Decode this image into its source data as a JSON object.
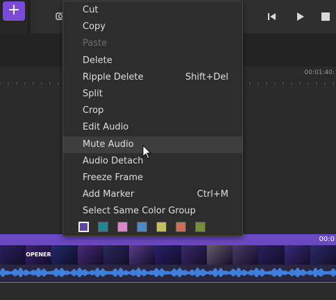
{
  "toolbar": {
    "add_glyph": "+"
  },
  "ruler": {
    "tick_time": "00:01:40:"
  },
  "track": {
    "time": "00:0"
  },
  "video_thumbs": [
    {
      "label": "",
      "color": "#2a1f5c"
    },
    {
      "label": "OPENERS",
      "color": "#3a1f6e"
    },
    {
      "label": "",
      "color": "#1f2a6a"
    },
    {
      "label": "",
      "color": "#4a2a7a"
    },
    {
      "label": "",
      "color": "#2a2a5c"
    },
    {
      "label": "",
      "color": "#5a3a8a"
    },
    {
      "label": "",
      "color": "#2a1f6c"
    },
    {
      "label": "",
      "color": "#3a2a6a"
    },
    {
      "label": "",
      "color": "#6a5a6a"
    },
    {
      "label": "",
      "color": "#4a3a6a"
    },
    {
      "label": "",
      "color": "#2a1f5c"
    },
    {
      "label": "",
      "color": "#3a2a7a"
    },
    {
      "label": "",
      "color": "#2a2a6a"
    }
  ],
  "context_menu": {
    "items": [
      {
        "label": "Cut",
        "shortcut": "",
        "disabled": false
      },
      {
        "label": "Copy",
        "shortcut": "",
        "disabled": false
      },
      {
        "label": "Paste",
        "shortcut": "",
        "disabled": true
      },
      {
        "label": "Delete",
        "shortcut": "",
        "disabled": false
      },
      {
        "label": "Ripple Delete",
        "shortcut": "Shift+Del",
        "disabled": false
      },
      {
        "label": "Split",
        "shortcut": "",
        "disabled": false
      },
      {
        "label": "Crop",
        "shortcut": "",
        "disabled": false
      },
      {
        "label": "Edit Audio",
        "shortcut": "",
        "disabled": false
      },
      {
        "label": "Mute Audio",
        "shortcut": "",
        "disabled": false,
        "hover": true
      },
      {
        "label": "Audio Detach",
        "shortcut": "",
        "disabled": false
      },
      {
        "label": "Freeze Frame",
        "shortcut": "",
        "disabled": false
      },
      {
        "label": "Add Marker",
        "shortcut": "Ctrl+M",
        "disabled": false
      },
      {
        "label": "Select Same Color Group",
        "shortcut": "",
        "disabled": false
      }
    ],
    "color_swatches": [
      "#5b45a8",
      "#22858f",
      "#d888c8",
      "#4f88c4",
      "#c4c060",
      "#c8705a",
      "#788a3c"
    ],
    "selected_swatch": 0
  }
}
